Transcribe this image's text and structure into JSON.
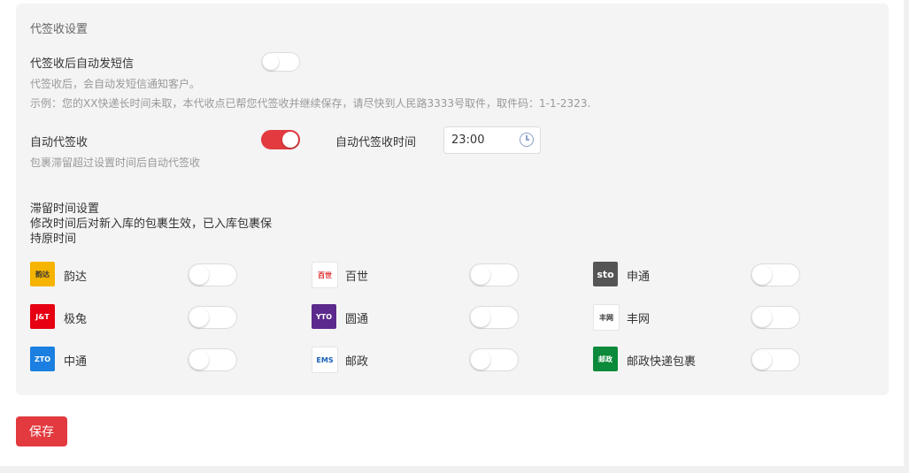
{
  "section": {
    "title": "代签收设置"
  },
  "sms": {
    "label": "代签收后自动发短信",
    "desc1": "代签收后，会自动发短信通知客户。",
    "desc2": "示例：您的XX快递长时间未取，本代收点已帮您代签收并继续保存，请尽快到人民路3333号取件，取件码：1-1-2323.",
    "enabled": false
  },
  "auto_sign": {
    "label": "自动代签收",
    "desc": "包裹滞留超过设置时间后自动代签收",
    "enabled": true,
    "time_label": "自动代签收时间",
    "time_value": "23:00"
  },
  "retention": {
    "title": "滞留时间设置",
    "desc_line1": "修改时间后对新入库的包裹生效，已入库包裹保",
    "desc_line2": "持原时间"
  },
  "couriers": [
    {
      "name": "韵达",
      "logo_text": "韵达",
      "logo_color": "#f5b400",
      "icon": "yunda-logo-icon",
      "enabled": false
    },
    {
      "name": "百世",
      "logo_text": "百世",
      "logo_color": "#ffffff",
      "icon": "baishi-logo-icon",
      "enabled": false
    },
    {
      "name": "申通",
      "logo_text": "sto",
      "logo_color": "#555555",
      "icon": "sto-logo-icon",
      "enabled": false
    },
    {
      "name": "极兔",
      "logo_text": "J&T",
      "logo_color": "#e60012",
      "icon": "jitu-logo-icon",
      "enabled": false
    },
    {
      "name": "圆通",
      "logo_text": "YTO",
      "logo_color": "#5b2a8c",
      "icon": "yto-logo-icon",
      "enabled": false
    },
    {
      "name": "丰网",
      "logo_text": "丰网",
      "logo_color": "#ffffff",
      "icon": "fengwang-logo-icon",
      "enabled": false
    },
    {
      "name": "中通",
      "logo_text": "ZTO",
      "logo_color": "#1a7fe0",
      "icon": "zto-logo-icon",
      "enabled": false
    },
    {
      "name": "邮政",
      "logo_text": "EMS",
      "logo_color": "#ffffff",
      "icon": "ems-logo-icon",
      "enabled": false
    },
    {
      "name": "邮政快递包裹",
      "logo_text": "邮政",
      "logo_color": "#0a8a3a",
      "icon": "post-logo-icon",
      "enabled": false
    }
  ],
  "actions": {
    "save_label": "保存"
  }
}
